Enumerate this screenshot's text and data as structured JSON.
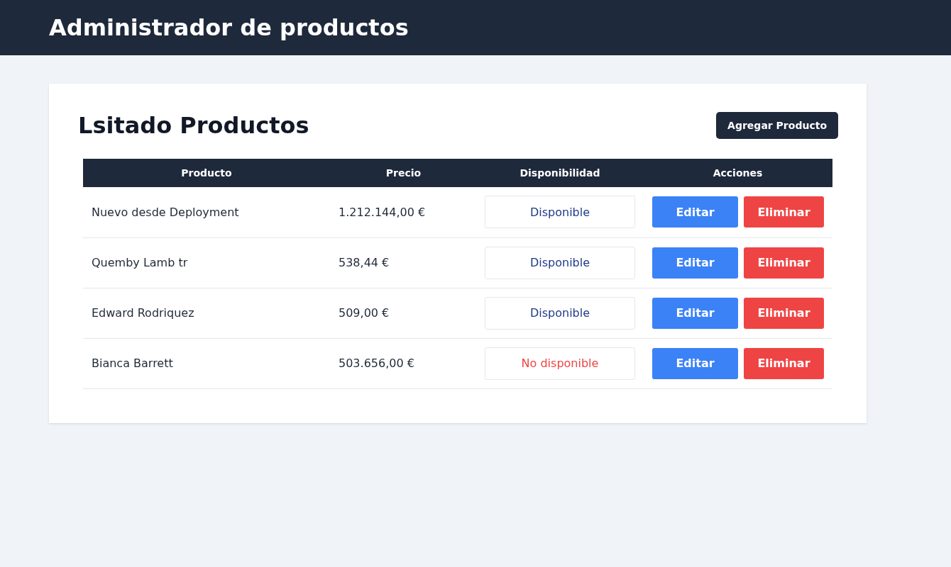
{
  "header": {
    "title": "Administrador de productos"
  },
  "card": {
    "title": "Lsitado Productos",
    "add_button": "Agregar Producto"
  },
  "table": {
    "columns": [
      "Producto",
      "Precio",
      "Disponibilidad",
      "Acciones"
    ],
    "rows": [
      {
        "name": "Nuevo desde Deployment",
        "price": "1.212.144,00 €",
        "availability": "Disponible",
        "available": true,
        "edit": "Editar",
        "delete": "Eliminar"
      },
      {
        "name": "Quemby Lamb tr",
        "price": "538,44 €",
        "availability": "Disponible",
        "available": true,
        "edit": "Editar",
        "delete": "Eliminar"
      },
      {
        "name": "Edward Rodriquez",
        "price": "509,00 €",
        "availability": "Disponible",
        "available": true,
        "edit": "Editar",
        "delete": "Eliminar"
      },
      {
        "name": "Bianca Barrett",
        "price": "503.656,00 €",
        "availability": "No disponible",
        "available": false,
        "edit": "Editar",
        "delete": "Eliminar"
      }
    ]
  }
}
